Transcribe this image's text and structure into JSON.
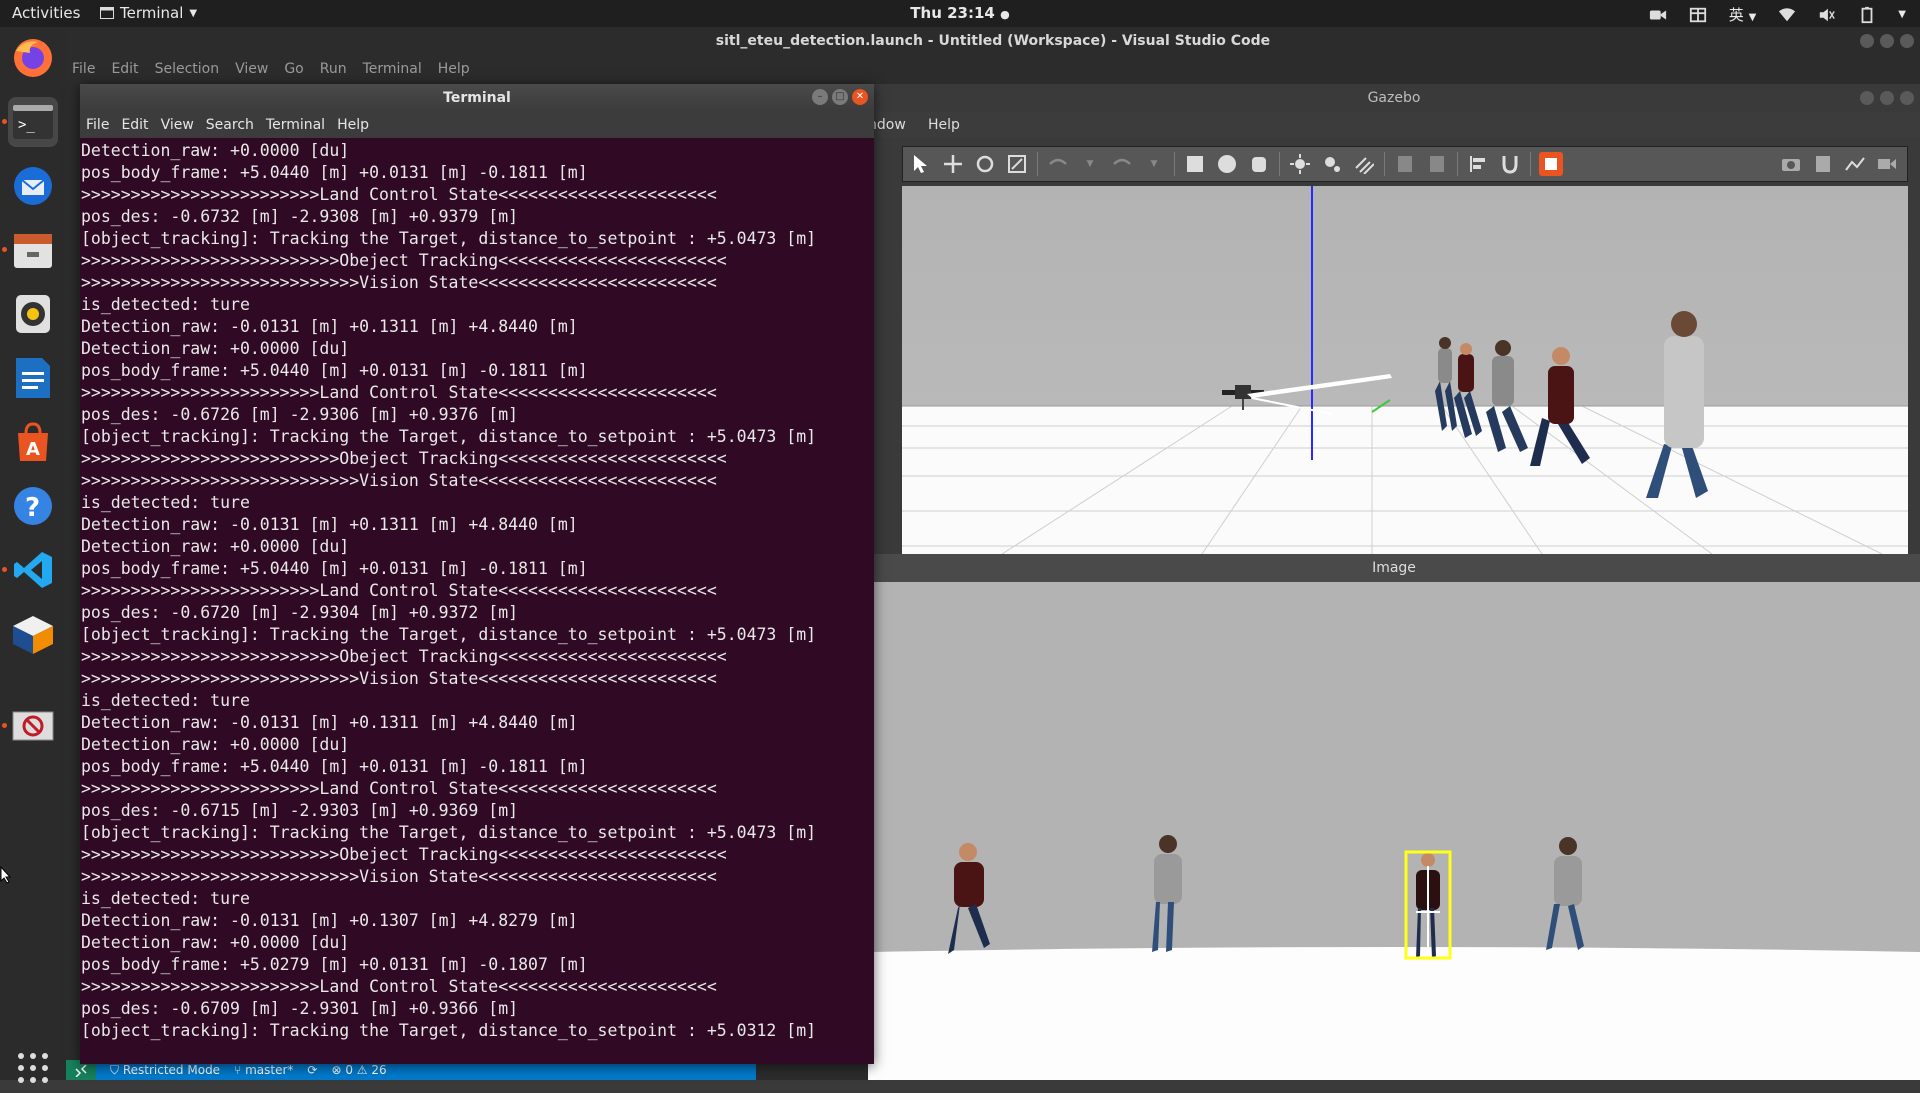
{
  "topbar": {
    "activities": "Activities",
    "app_menu": "Terminal",
    "clock": "Thu 23:14",
    "input_method": "英"
  },
  "dock": {
    "items": [
      "firefox-icon",
      "terminal-icon",
      "thunderbird-icon",
      "files-icon",
      "rhythmbox-icon",
      "libreoffice-writer-icon",
      "ubuntu-software-icon",
      "help-icon",
      "vscode-icon",
      "virtualbox-icon",
      "apps-grid-icon"
    ]
  },
  "vscode": {
    "title": "sitl_eteu_detection.launch - Untitled (Workspace) - Visual Studio Code",
    "menu": [
      "File",
      "Edit",
      "Selection",
      "View",
      "Go",
      "Run",
      "Terminal",
      "Help"
    ],
    "status": {
      "restricted": "Restricted Mode",
      "branch": "master*",
      "problems": "⊗ 0 ⚠ 26"
    }
  },
  "gazebo": {
    "title": "Gazebo",
    "menu_window": "ndow",
    "menu_help": "Help",
    "image_label": "Image"
  },
  "terminal": {
    "title": "Terminal",
    "menu": [
      "File",
      "Edit",
      "View",
      "Search",
      "Terminal",
      "Help"
    ],
    "lines": [
      "Detection_raw: +0.0000 [du]",
      "pos_body_frame: +5.0440 [m] +0.0131 [m] -0.1811 [m]",
      ">>>>>>>>>>>>>>>>>>>>>>>>Land Control State<<<<<<<<<<<<<<<<<<<<<<",
      "pos_des: -0.6732 [m] -2.9308 [m] +0.9379 [m]",
      "[object_tracking]: Tracking the Target, distance_to_setpoint : +5.0473 [m]",
      ">>>>>>>>>>>>>>>>>>>>>>>>>>Obeject Tracking<<<<<<<<<<<<<<<<<<<<<<<",
      ">>>>>>>>>>>>>>>>>>>>>>>>>>>>Vision State<<<<<<<<<<<<<<<<<<<<<<<<",
      "is_detected: ture",
      "Detection_raw: -0.0131 [m] +0.1311 [m] +4.8440 [m]",
      "Detection_raw: +0.0000 [du]",
      "pos_body_frame: +5.0440 [m] +0.0131 [m] -0.1811 [m]",
      ">>>>>>>>>>>>>>>>>>>>>>>>Land Control State<<<<<<<<<<<<<<<<<<<<<<",
      "pos_des: -0.6726 [m] -2.9306 [m] +0.9376 [m]",
      "[object_tracking]: Tracking the Target, distance_to_setpoint : +5.0473 [m]",
      ">>>>>>>>>>>>>>>>>>>>>>>>>>Obeject Tracking<<<<<<<<<<<<<<<<<<<<<<<",
      ">>>>>>>>>>>>>>>>>>>>>>>>>>>>Vision State<<<<<<<<<<<<<<<<<<<<<<<<",
      "is_detected: ture",
      "Detection_raw: -0.0131 [m] +0.1311 [m] +4.8440 [m]",
      "Detection_raw: +0.0000 [du]",
      "pos_body_frame: +5.0440 [m] +0.0131 [m] -0.1811 [m]",
      ">>>>>>>>>>>>>>>>>>>>>>>>Land Control State<<<<<<<<<<<<<<<<<<<<<<",
      "pos_des: -0.6720 [m] -2.9304 [m] +0.9372 [m]",
      "[object_tracking]: Tracking the Target, distance_to_setpoint : +5.0473 [m]",
      ">>>>>>>>>>>>>>>>>>>>>>>>>>Obeject Tracking<<<<<<<<<<<<<<<<<<<<<<<",
      ">>>>>>>>>>>>>>>>>>>>>>>>>>>>Vision State<<<<<<<<<<<<<<<<<<<<<<<<",
      "is_detected: ture",
      "Detection_raw: -0.0131 [m] +0.1311 [m] +4.8440 [m]",
      "Detection_raw: +0.0000 [du]",
      "pos_body_frame: +5.0440 [m] +0.0131 [m] -0.1811 [m]",
      ">>>>>>>>>>>>>>>>>>>>>>>>Land Control State<<<<<<<<<<<<<<<<<<<<<<",
      "pos_des: -0.6715 [m] -2.9303 [m] +0.9369 [m]",
      "[object_tracking]: Tracking the Target, distance_to_setpoint : +5.0473 [m]",
      ">>>>>>>>>>>>>>>>>>>>>>>>>>Obeject Tracking<<<<<<<<<<<<<<<<<<<<<<<",
      ">>>>>>>>>>>>>>>>>>>>>>>>>>>>Vision State<<<<<<<<<<<<<<<<<<<<<<<<",
      "is_detected: ture",
      "Detection_raw: -0.0131 [m] +0.1307 [m] +4.8279 [m]",
      "Detection_raw: +0.0000 [du]",
      "pos_body_frame: +5.0279 [m] +0.0131 [m] -0.1807 [m]",
      ">>>>>>>>>>>>>>>>>>>>>>>>Land Control State<<<<<<<<<<<<<<<<<<<<<<",
      "pos_des: -0.6709 [m] -2.9301 [m] +0.9366 [m]",
      "[object_tracking]: Tracking the Target, distance_to_setpoint : +5.0312 [m]"
    ]
  }
}
